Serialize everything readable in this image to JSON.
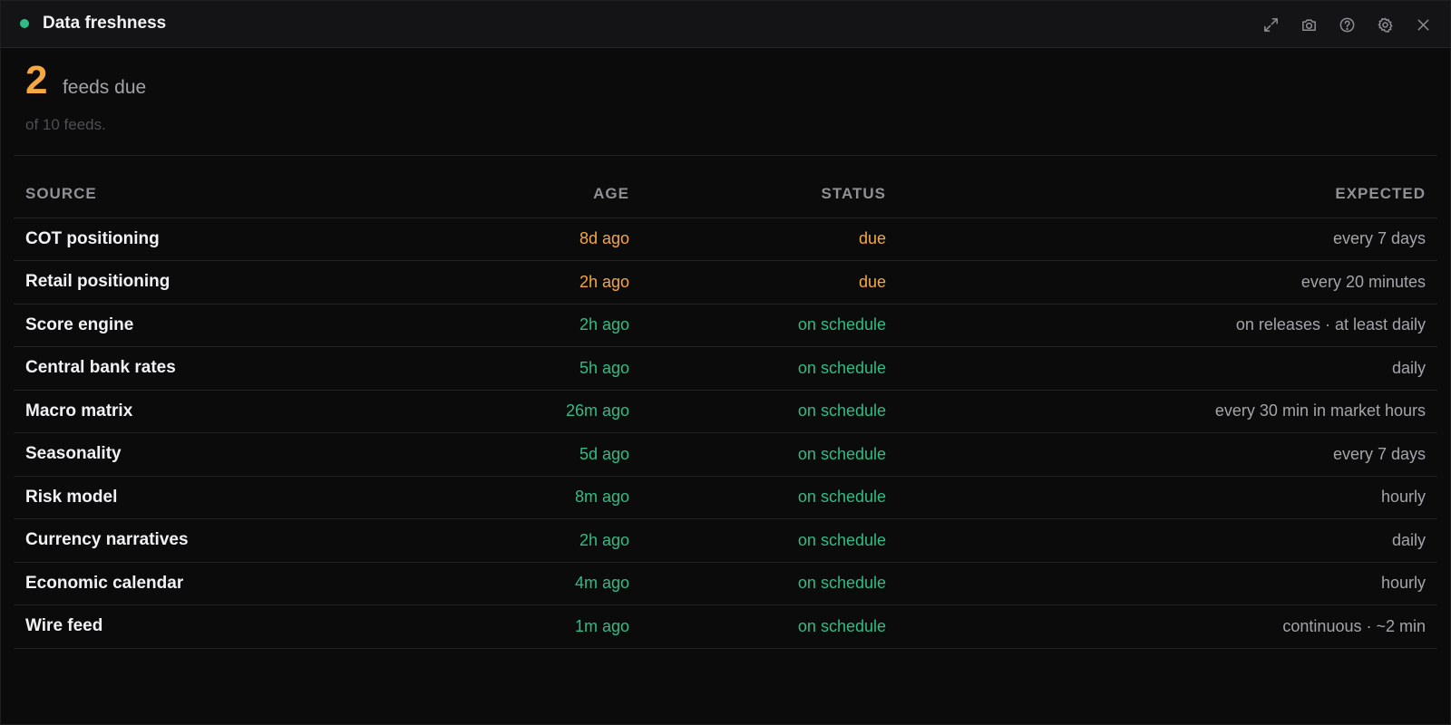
{
  "window": {
    "title": "Data freshness",
    "icons": [
      "expand-icon",
      "camera-icon",
      "help-icon",
      "gear-icon",
      "close-icon"
    ]
  },
  "summary": {
    "count": "2",
    "count_label": "feeds due",
    "subtext": "of 10 feeds."
  },
  "colors": {
    "due": "#f5a742",
    "ok": "#2ebd85",
    "dot": "#2ebd85"
  },
  "table": {
    "headers": {
      "source": "SOURCE",
      "age": "AGE",
      "status": "STATUS",
      "expected": "EXPECTED"
    },
    "rows": [
      {
        "source": "COT positioning",
        "age": "8d ago",
        "status": "due",
        "expected": "every 7 days",
        "state": "due"
      },
      {
        "source": "Retail positioning",
        "age": "2h ago",
        "status": "due",
        "expected": "every 20 minutes",
        "state": "due"
      },
      {
        "source": "Score engine",
        "age": "2h ago",
        "status": "on schedule",
        "expected": "on releases · at least daily",
        "state": "ok"
      },
      {
        "source": "Central bank rates",
        "age": "5h ago",
        "status": "on schedule",
        "expected": "daily",
        "state": "ok"
      },
      {
        "source": "Macro matrix",
        "age": "26m ago",
        "status": "on schedule",
        "expected": "every 30 min in market hours",
        "state": "ok"
      },
      {
        "source": "Seasonality",
        "age": "5d ago",
        "status": "on schedule",
        "expected": "every 7 days",
        "state": "ok"
      },
      {
        "source": "Risk model",
        "age": "8m ago",
        "status": "on schedule",
        "expected": "hourly",
        "state": "ok"
      },
      {
        "source": "Currency narratives",
        "age": "2h ago",
        "status": "on schedule",
        "expected": "daily",
        "state": "ok"
      },
      {
        "source": "Economic calendar",
        "age": "4m ago",
        "status": "on schedule",
        "expected": "hourly",
        "state": "ok"
      },
      {
        "source": "Wire feed",
        "age": "1m ago",
        "status": "on schedule",
        "expected": "continuous · ~2 min",
        "state": "ok"
      }
    ]
  }
}
